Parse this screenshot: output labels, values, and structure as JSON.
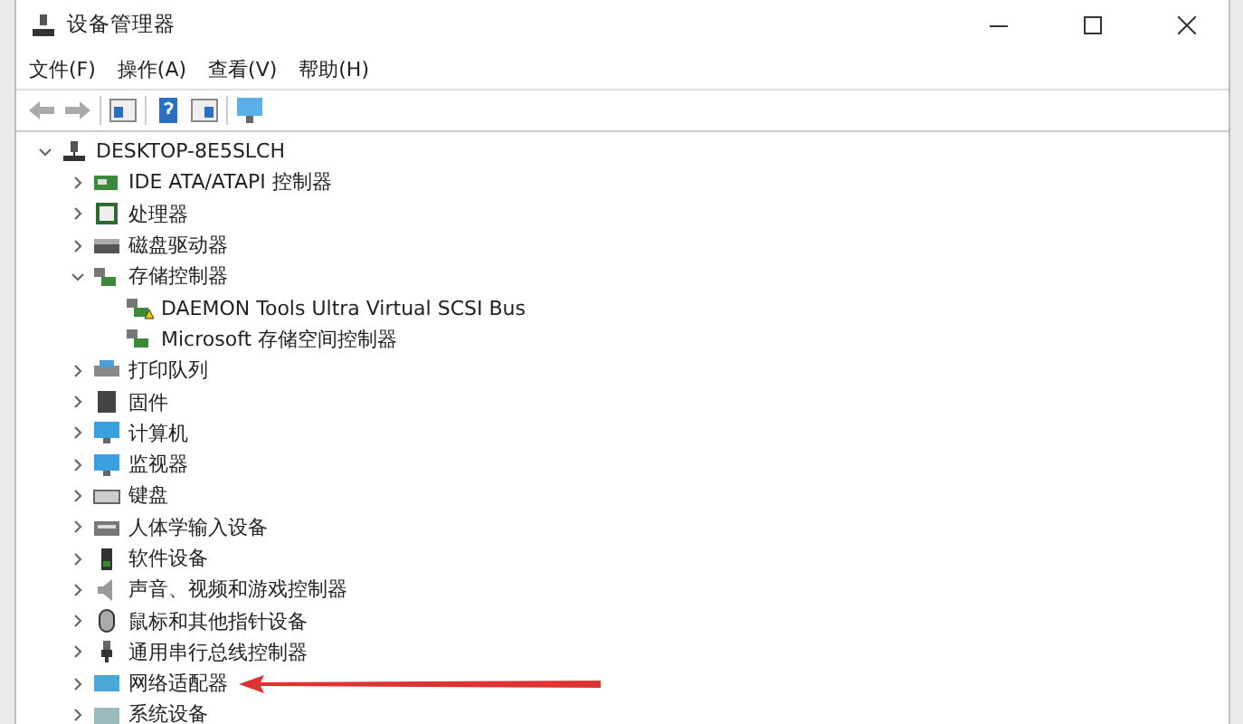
{
  "window": {
    "title": "设备管理器"
  },
  "menu": [
    "文件(F)",
    "操作(A)",
    "查看(V)",
    "帮助(H)"
  ],
  "toolbar": [
    {
      "kind": "back",
      "disabled": true
    },
    {
      "kind": "forward",
      "disabled": true
    },
    {
      "kind": "separator"
    },
    {
      "kind": "properties",
      "disabled": false
    },
    {
      "kind": "separator"
    },
    {
      "kind": "help",
      "disabled": false
    },
    {
      "kind": "panel",
      "disabled": false
    },
    {
      "kind": "separator"
    },
    {
      "kind": "scan",
      "disabled": false
    }
  ],
  "tree": [
    {
      "label": "DESKTOP-8E5SLCH",
      "kind": "computer",
      "expanded": true,
      "children": [
        {
          "label": "IDE ATA/ATAPI 控制器",
          "kind": "controller",
          "expanded": false
        },
        {
          "label": "处理器",
          "kind": "chip",
          "expanded": false
        },
        {
          "label": "磁盘驱动器",
          "kind": "disk",
          "expanded": false
        },
        {
          "label": "存储控制器",
          "kind": "storage",
          "expanded": true,
          "children": [
            {
              "label": "DAEMON Tools Ultra Virtual SCSI Bus",
              "kind": "storage",
              "warning": true
            },
            {
              "label": "Microsoft 存储空间控制器",
              "kind": "storage",
              "warning": false
            }
          ]
        },
        {
          "label": "打印队列",
          "kind": "printer",
          "expanded": false
        },
        {
          "label": "固件",
          "kind": "firmware",
          "expanded": false
        },
        {
          "label": "计算机",
          "kind": "monitor",
          "expanded": false
        },
        {
          "label": "监视器",
          "kind": "monitor",
          "expanded": false
        },
        {
          "label": "键盘",
          "kind": "keyboard",
          "expanded": false
        },
        {
          "label": "人体学输入设备",
          "kind": "hid",
          "expanded": false
        },
        {
          "label": "软件设备",
          "kind": "software",
          "expanded": false
        },
        {
          "label": "声音、视频和游戏控制器",
          "kind": "speaker",
          "expanded": false
        },
        {
          "label": "鼠标和其他指针设备",
          "kind": "mouse",
          "expanded": false
        },
        {
          "label": "通用串行总线控制器",
          "kind": "usb",
          "expanded": false
        },
        {
          "label": "网络适配器",
          "kind": "network",
          "expanded": false,
          "annotated": true
        },
        {
          "label": "系统设备",
          "kind": "system",
          "expanded": false
        }
      ]
    }
  ]
}
